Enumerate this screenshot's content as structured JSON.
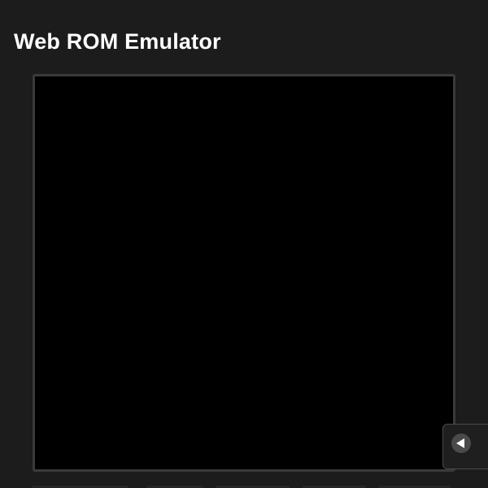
{
  "header": {
    "title": "Web ROM Emulator"
  },
  "screen": {
    "background": "#000000",
    "frame_color": "#3a3a3a"
  },
  "side_panel_toggle": {
    "icon": "triangle-left-icon"
  },
  "colors": {
    "page_background": "#1c1c1c",
    "text": "#ffffff"
  }
}
